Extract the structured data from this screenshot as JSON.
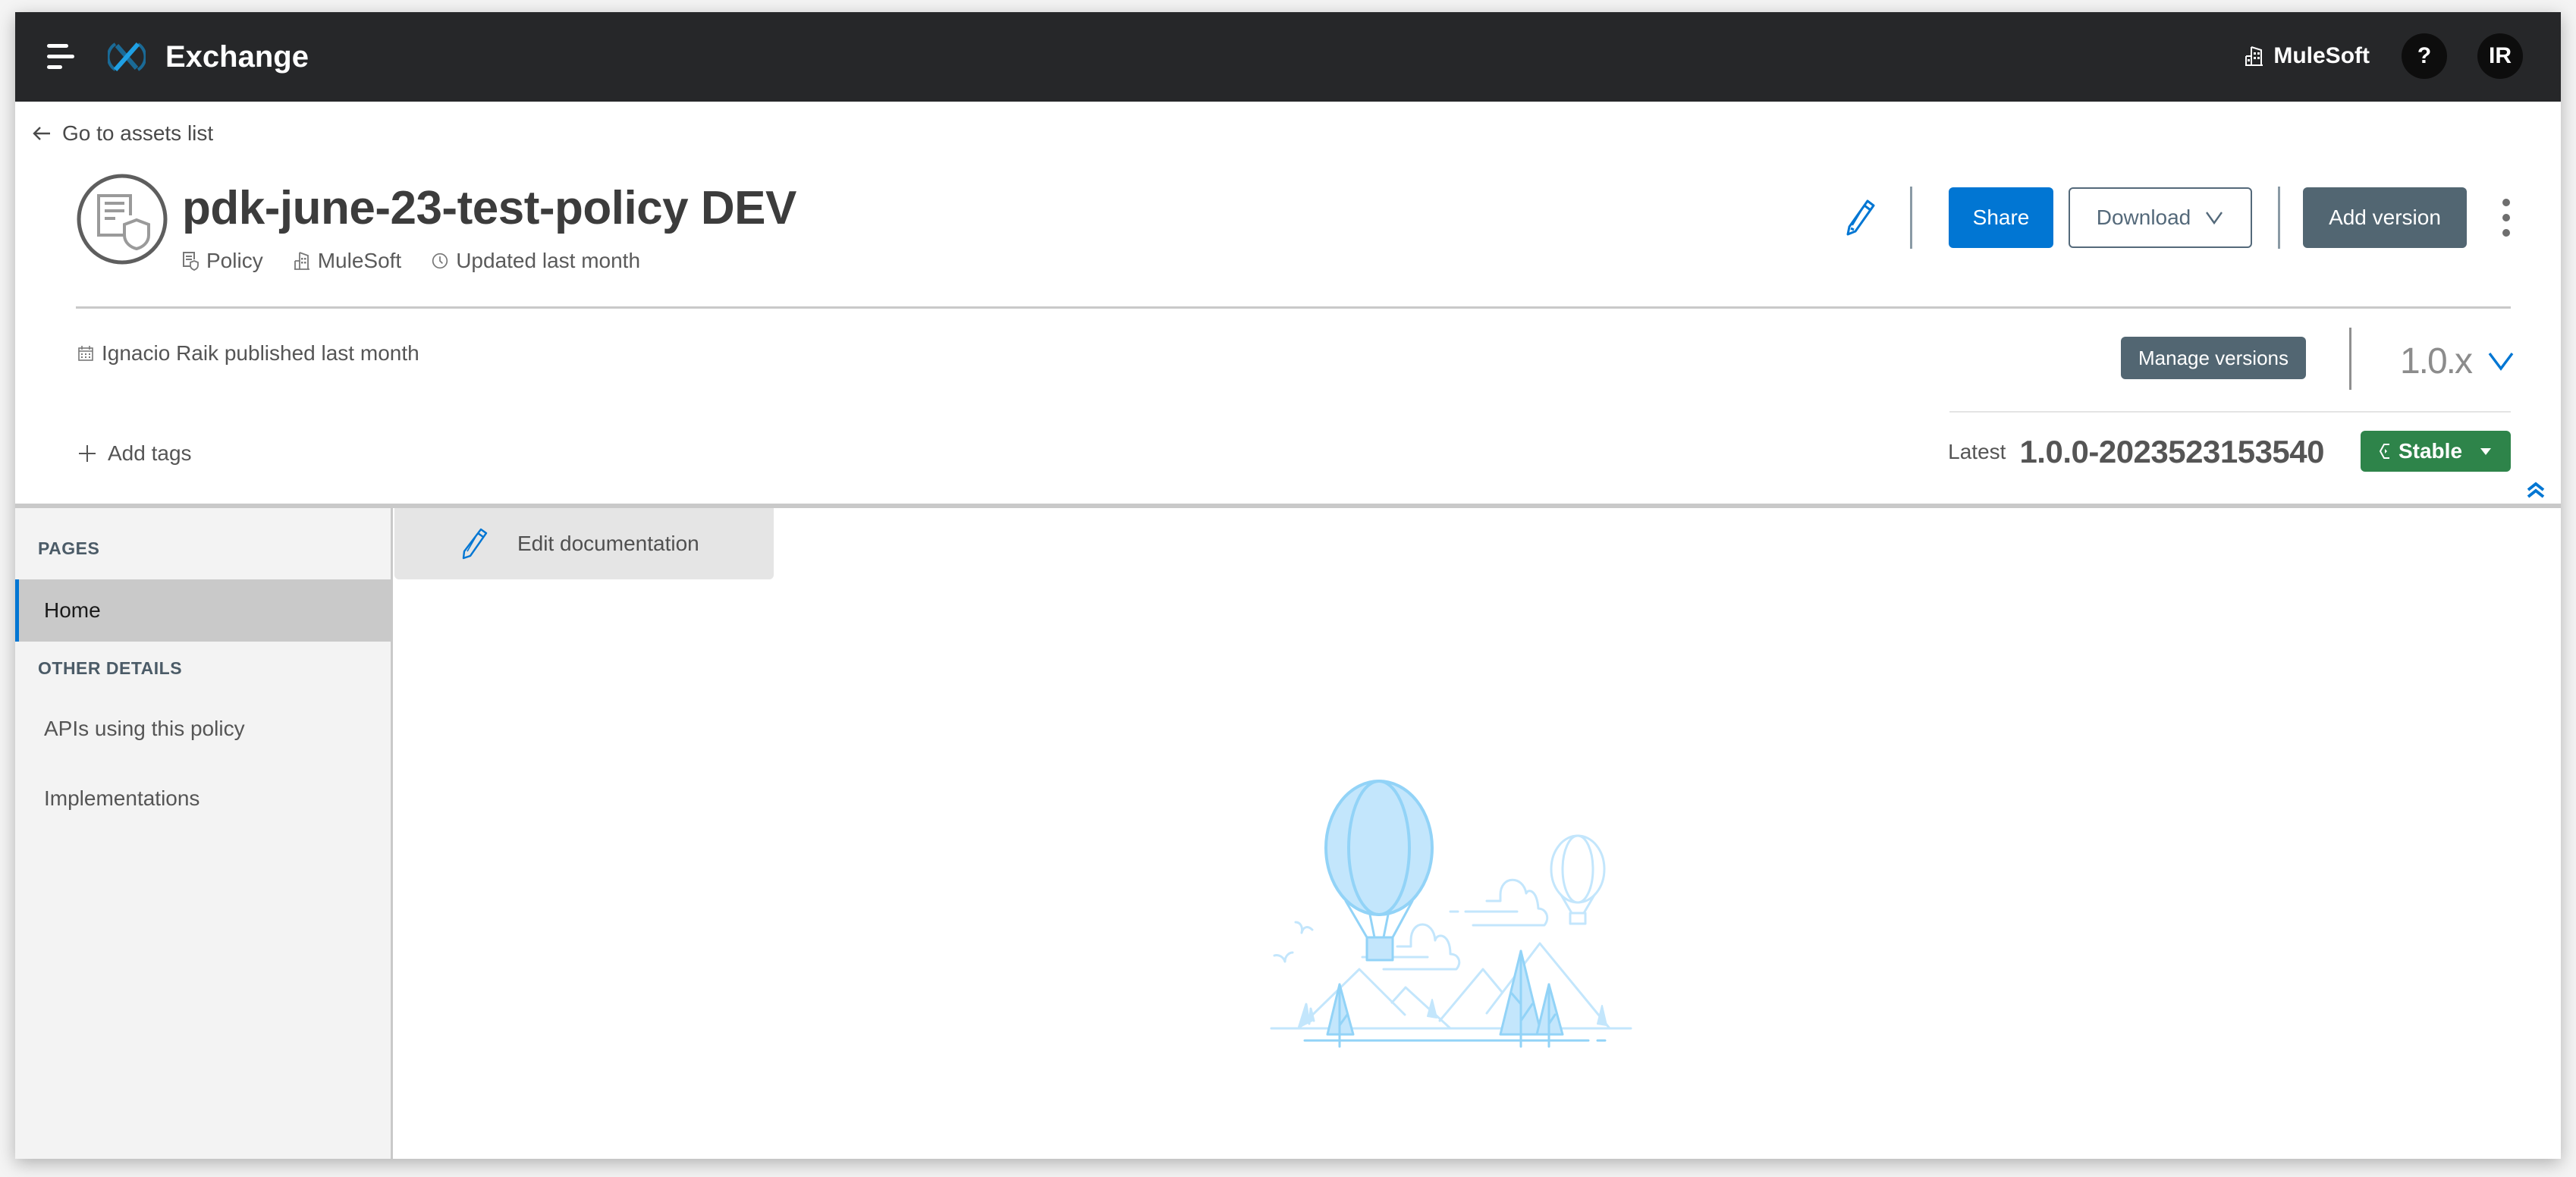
{
  "topbar": {
    "app_title": "Exchange",
    "org_name": "MuleSoft",
    "help_label": "?",
    "user_initials": "IR",
    "bg_color": "#262729"
  },
  "back_link": {
    "label": "Go to assets list"
  },
  "asset": {
    "title": "pdk-june-23-test-policy DEV",
    "meta": {
      "type": "Policy",
      "organization": "MuleSoft",
      "updated": "Updated last month"
    },
    "published": "Ignacio Raik published last month",
    "add_tags_label": "Add tags"
  },
  "actions": {
    "share_label": "Share",
    "download_label": "Download",
    "add_version_label": "Add version"
  },
  "versions": {
    "manage_label": "Manage versions",
    "selected_minor": "1.0.x",
    "latest_label": "Latest",
    "latest_version": "1.0.0-2023523153540",
    "lifecycle_status": "Stable",
    "status_color": "#2e844a"
  },
  "sidebar": {
    "pages_heading": "PAGES",
    "pages": [
      {
        "label": "Home",
        "active": true
      }
    ],
    "other_heading": "OTHER DETAILS",
    "other_items": [
      {
        "label": "APIs using this policy"
      },
      {
        "label": "Implementations"
      }
    ]
  },
  "content": {
    "edit_doc_label": "Edit documentation",
    "illustration": "hot-air-balloons-empty-state"
  },
  "colors": {
    "accent": "#0176d3",
    "secondary_button": "#526672"
  }
}
